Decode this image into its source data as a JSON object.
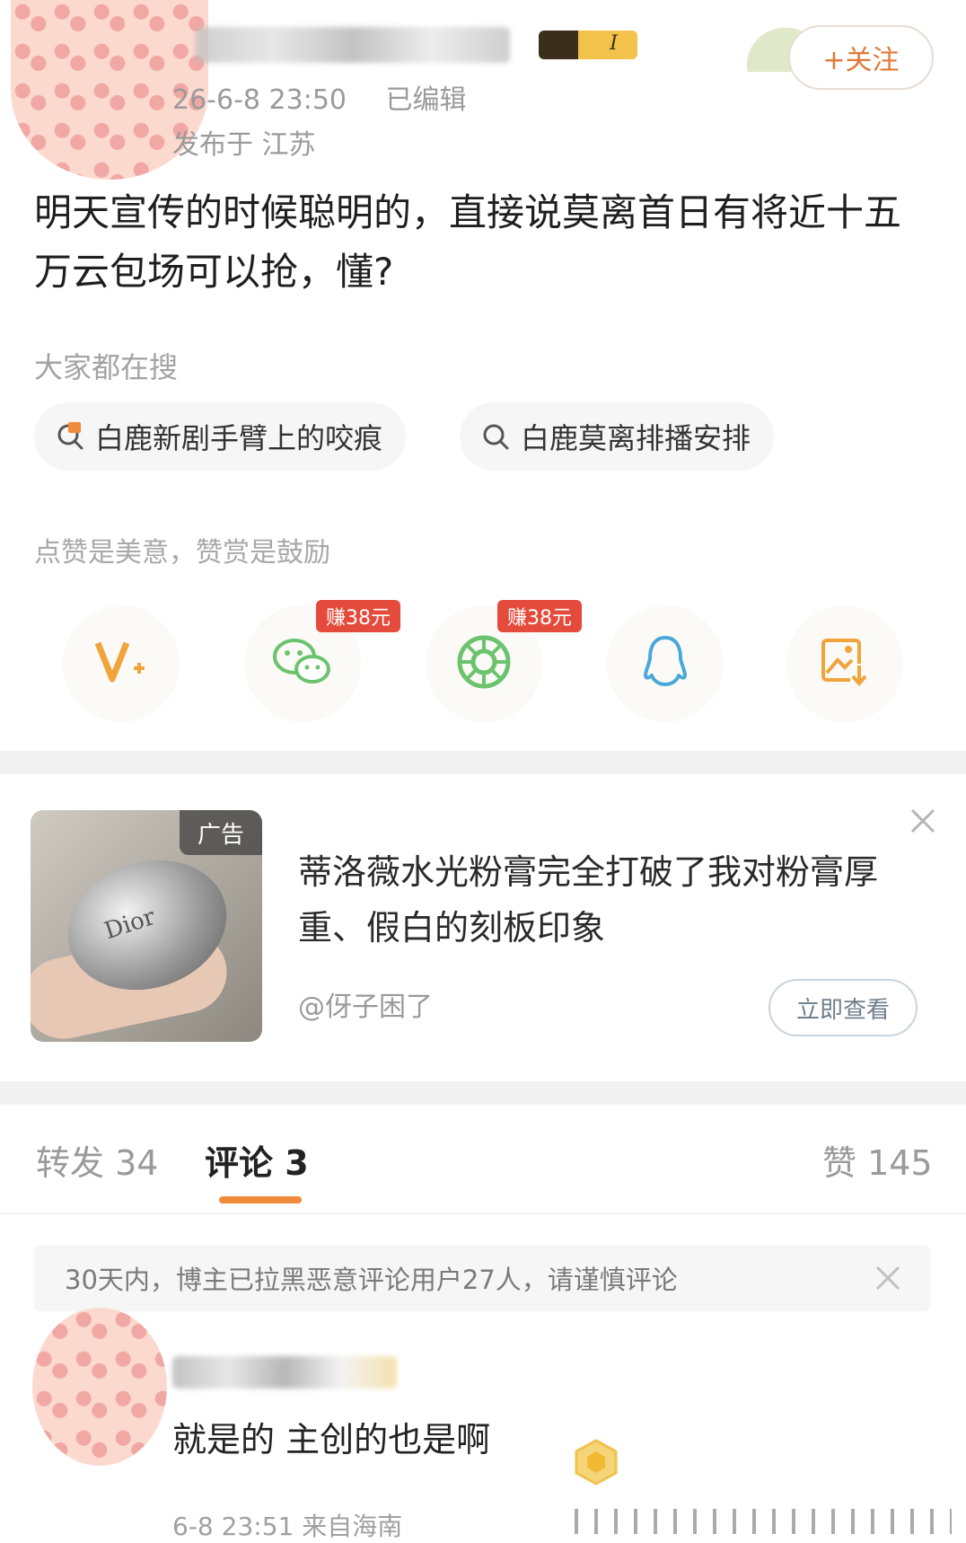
{
  "header": {
    "username": "████ forever██",
    "vip_level": "I",
    "follow_label": "+关注",
    "time": "26-6-8 23:50",
    "edited": "已编辑",
    "location": "发布于 江苏"
  },
  "post": {
    "text": "明天宣传的时候聪明的，直接说莫离首日有将近十五万云包场可以抢，懂?"
  },
  "search": {
    "title": "大家都在搜",
    "chips": [
      {
        "label": "白鹿新剧手臂上的咬痕",
        "icon": "hot-search-icon"
      },
      {
        "label": "白鹿莫离排播安排",
        "icon": "search-icon"
      }
    ]
  },
  "reward": {
    "tip": "点赞是美意，赞赏是鼓励",
    "share_buttons": [
      {
        "name": "reward-v-button",
        "icon": "v-plus-icon"
      },
      {
        "name": "share-wechat-button",
        "icon": "wechat-icon",
        "badge": "赚38元"
      },
      {
        "name": "share-moments-button",
        "icon": "moments-icon",
        "badge": "赚38元"
      },
      {
        "name": "share-qq-button",
        "icon": "qq-icon"
      },
      {
        "name": "save-image-button",
        "icon": "save-image-icon"
      }
    ],
    "colors": {
      "v": "#f0a43a",
      "wechat": "#6cc36e",
      "moments": "#6cc36e",
      "qq": "#4aa8d8",
      "save": "#f0a43a"
    }
  },
  "ad": {
    "tag": "广告",
    "brand_text": "Dior",
    "text": "蒂洛薇水光粉膏完全打破了我对粉膏厚重、假白的刻板印象",
    "author": "@伢子困了",
    "cta": "立即查看"
  },
  "tabs": {
    "repost": "转发 34",
    "comment": "评论 3",
    "likes": "赞 145",
    "accent": "#f08b3b"
  },
  "notice": {
    "text": "30天内，博主已拉黑恶意评论用户27人，请谨慎评论"
  },
  "comment": {
    "name": "██ ███",
    "text": "就是的 主创的也是啊",
    "meta": "6-8 23:51 来自海南"
  }
}
